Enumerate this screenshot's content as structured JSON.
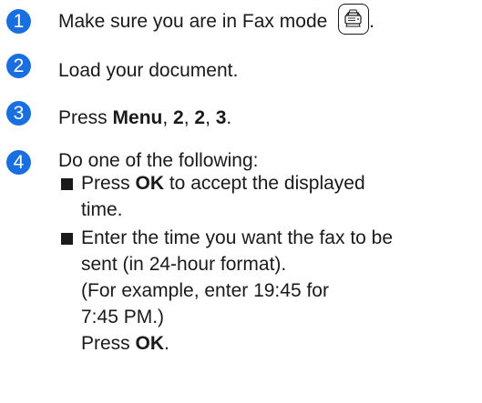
{
  "steps": [
    {
      "number": "1",
      "text_before_icon": "Make sure you are in Fax mode",
      "icon": "fax-mode-icon",
      "text_after_icon": "."
    },
    {
      "number": "2",
      "text": "Load your document."
    },
    {
      "number": "3",
      "prefix": "Press ",
      "key_menu": "Menu",
      "sep1": ", ",
      "key_a": "2",
      "sep2": ", ",
      "key_b": "2",
      "sep3": ", ",
      "key_c": "3",
      "suffix": "."
    },
    {
      "number": "4",
      "text": "Do one of the following:"
    }
  ],
  "bullets": [
    {
      "prefix": "Press ",
      "key": "OK",
      "rest_line1": " to accept the displayed",
      "line2": "time."
    },
    {
      "line1": "Enter the time you want the fax to be",
      "line2": "sent (in 24-hour format).",
      "line3": "(For example, enter 19:45 for",
      "line4": "7:45 PM.)",
      "line5_prefix": "Press ",
      "line5_key": "OK",
      "line5_suffix": "."
    }
  ],
  "colors": {
    "step_badge": "#1a6fe0",
    "text": "#1a1a1a"
  }
}
